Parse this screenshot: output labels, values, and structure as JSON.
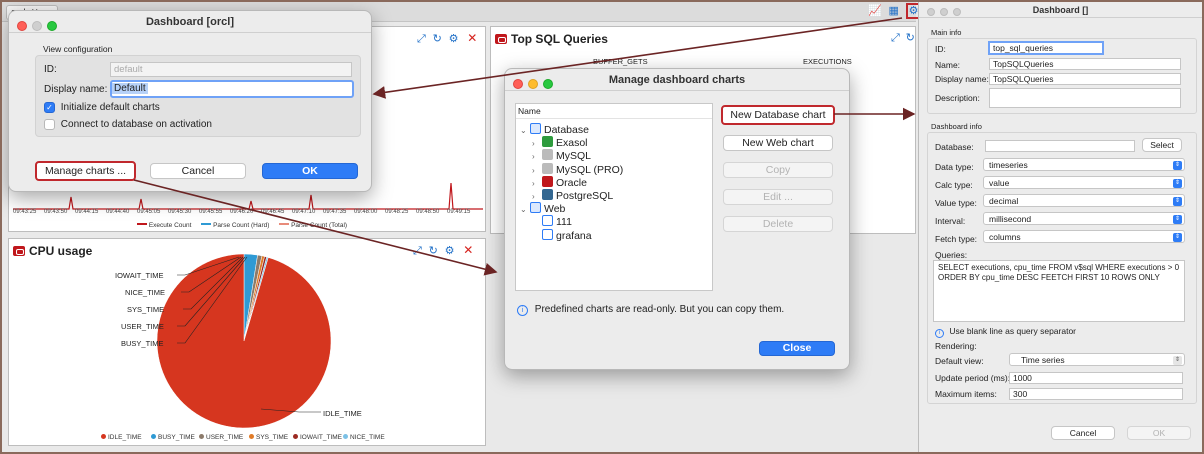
{
  "workspace": {
    "tab_label": "orcl",
    "panel_sql_title": "Top SQL Queries",
    "panel_cpu_title": "CPU usage",
    "sql_labels": [
      "BUFFER_GETS",
      "EXECUTIONS"
    ],
    "session_legend": [
      "Execute Count",
      "Parse Count (Hard)",
      "Parse Count (Total)"
    ],
    "time_ticks": [
      "09:43:25",
      "09:43:50",
      "09:44:15",
      "09:44:40",
      "09:45:05",
      "09:45:30",
      "09:45:55",
      "09:46:20",
      "09:46:45",
      "09:47:10",
      "09:47:35",
      "09:48:00",
      "09:48:25",
      "09:48:50",
      "09:49:15"
    ]
  },
  "cpu_chart": {
    "chart_data": {
      "type": "pie",
      "title": "CPU usage",
      "categories": [
        "IDLE_TIME",
        "BUSY_TIME",
        "USER_TIME",
        "SYS_TIME",
        "IOWAIT_TIME",
        "NICE_TIME"
      ],
      "values": [
        95.5,
        2.5,
        0.8,
        0.5,
        0.4,
        0.3
      ],
      "legend_position": "bottom"
    },
    "colors": [
      "#d6361f",
      "#2f9ad4",
      "#8c7b6b",
      "#e07b28",
      "#9c2a22",
      "#7cc1e6"
    ],
    "callouts": [
      "IOWAIT_TIME",
      "NICE_TIME",
      "SYS_TIME",
      "USER_TIME",
      "BUSY_TIME",
      "IDLE_TIME"
    ]
  },
  "dashboard_dialog": {
    "title": "Dashboard [orcl]",
    "section": "View configuration",
    "id_label": "ID:",
    "id_value": "default",
    "display_name_label": "Display name:",
    "display_name_value": "Default",
    "init_default_label": "Initialize default charts",
    "init_default_checked": true,
    "connect_label": "Connect to database on activation",
    "connect_checked": false,
    "manage_button": "Manage charts ...",
    "cancel_button": "Cancel",
    "ok_button": "OK"
  },
  "manage_dialog": {
    "title": "Manage dashboard charts",
    "tree_header": "Name",
    "tree": [
      {
        "label": "Database",
        "level": 0,
        "open": true,
        "icon": "database-icon",
        "color": "#2e7cf6"
      },
      {
        "label": "Exasol",
        "level": 1,
        "open": false,
        "icon": "exasol-icon",
        "color": "#2e9b3d"
      },
      {
        "label": "MySQL",
        "level": 1,
        "open": false,
        "icon": "mysql-icon",
        "color": "#bbbbbb"
      },
      {
        "label": "MySQL (PRO)",
        "level": 1,
        "open": false,
        "icon": "mysql-icon",
        "color": "#bbbbbb"
      },
      {
        "label": "Oracle",
        "level": 1,
        "open": false,
        "icon": "oracle-icon",
        "color": "#c0171c"
      },
      {
        "label": "PostgreSQL",
        "level": 1,
        "open": false,
        "icon": "postgresql-icon",
        "color": "#336791"
      },
      {
        "label": "Web",
        "level": 0,
        "open": true,
        "icon": "web-icon",
        "color": "#2e7cf6"
      },
      {
        "label": "111",
        "level": 1,
        "open": null,
        "icon": "chart-icon",
        "color": "#2e7cf6"
      },
      {
        "label": "grafana",
        "level": 1,
        "open": null,
        "icon": "chart-icon",
        "color": "#2e7cf6"
      }
    ],
    "new_db_chart": "New Database chart",
    "new_web_chart": "New Web chart",
    "copy": "Copy",
    "edit": "Edit ...",
    "delete": "Delete",
    "info": "Predefined charts are read-only. But you can copy them.",
    "close": "Close"
  },
  "chart_dialog": {
    "title": "Dashboard []",
    "main_info": "Main info",
    "id_label": "ID:",
    "id_value": "top_sql_queries",
    "name_label": "Name:",
    "name_value": "TopSQLQueries",
    "display_name_label": "Display name:",
    "display_name_value": "TopSQLQueries",
    "description_label": "Description:",
    "dashboard_info": "Dashboard info",
    "database_label": "Database:",
    "select_button": "Select",
    "data_type_label": "Data type:",
    "data_type_value": "timeseries",
    "calc_type_label": "Calc type:",
    "calc_type_value": "value",
    "value_type_label": "Value type:",
    "value_type_value": "decimal",
    "interval_label": "Interval:",
    "interval_value": "millisecond",
    "fetch_type_label": "Fetch type:",
    "fetch_type_value": "columns",
    "queries_label": "Queries:",
    "query_text": "SELECT executions, cpu_time FROM v$sql WHERE executions > 0 ORDER BY cpu_time DESC FEETCH FIRST 10 ROWS ONLY",
    "blank_line_hint": "Use blank line as query separator",
    "rendering_label": "Rendering:",
    "default_view_label": "Default view:",
    "default_view_value": "Time series",
    "update_period_label": "Update period (ms):",
    "update_period_value": "1000",
    "max_items_label": "Maximum items:",
    "max_items_value": "300",
    "cancel_button": "Cancel",
    "ok_button": "OK"
  }
}
